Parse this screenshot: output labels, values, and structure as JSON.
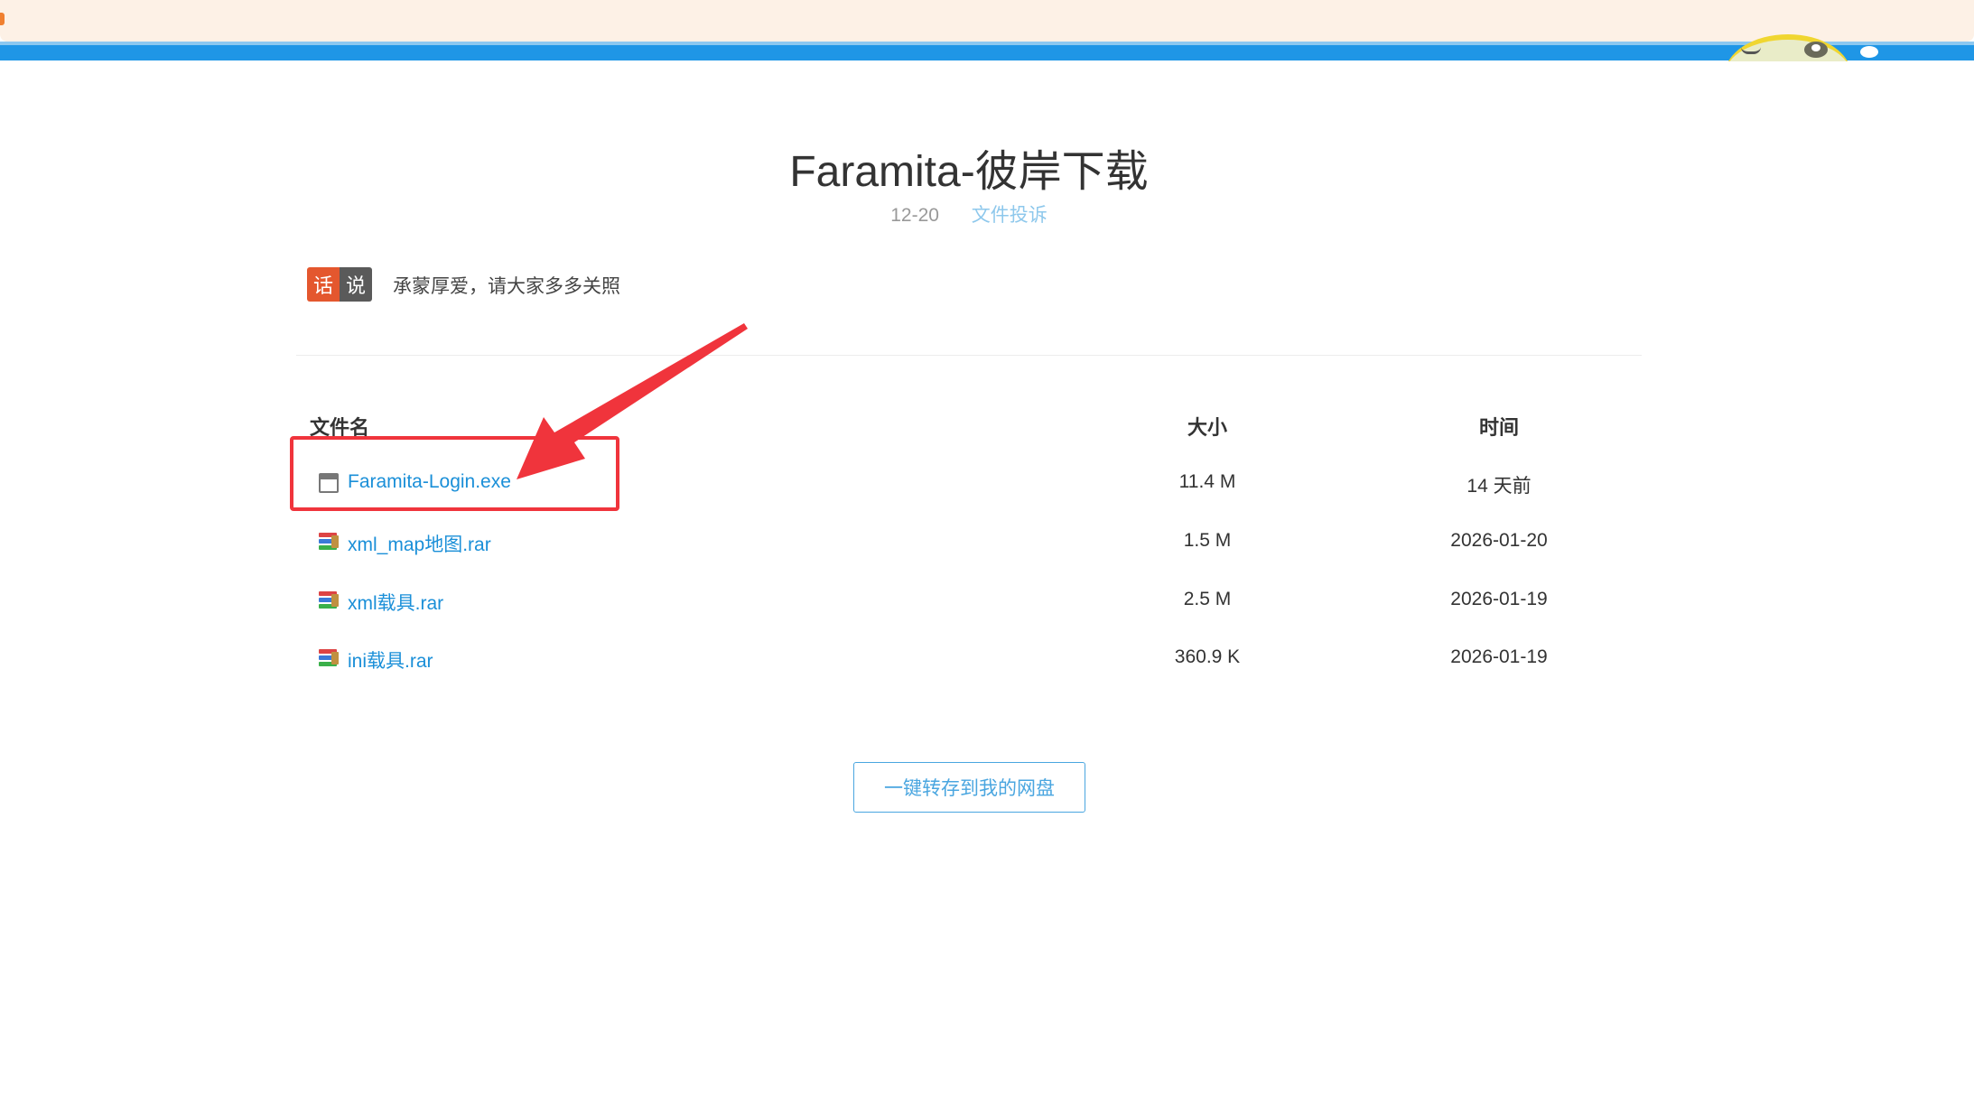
{
  "banner": {
    "accent": "#1f96e6"
  },
  "header": {
    "title": "Faramita-彼岸下载",
    "date": "12-20",
    "report_link": "文件投诉"
  },
  "notice": {
    "badge_left": "话",
    "badge_right": "说",
    "text": "承蒙厚爱，请大家多多关照"
  },
  "table": {
    "columns": {
      "name": "文件名",
      "size": "大小",
      "time": "时间"
    },
    "rows": [
      {
        "name": "Faramita-Login.exe",
        "size": "11.4 M",
        "time": "14 天前",
        "icon": "exe-window-icon"
      },
      {
        "name": "xml_map地图.rar",
        "size": "1.5 M",
        "time": "2026-01-20",
        "icon": "rar-archive-icon"
      },
      {
        "name": "xml载具.rar",
        "size": "2.5 M",
        "time": "2026-01-19",
        "icon": "rar-archive-icon"
      },
      {
        "name": "ini载具.rar",
        "size": "360.9 K",
        "time": "2026-01-19",
        "icon": "rar-archive-icon"
      }
    ]
  },
  "actions": {
    "save_to_disk": "一键转存到我的网盘"
  },
  "annotation": {
    "color": "#f0343c"
  }
}
